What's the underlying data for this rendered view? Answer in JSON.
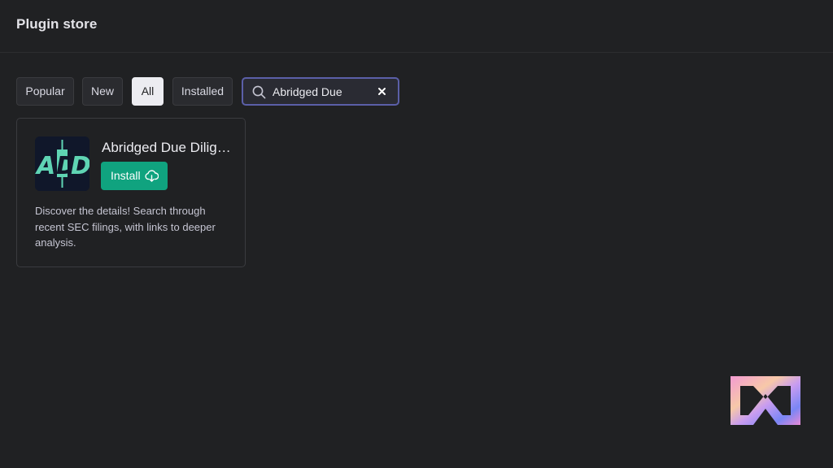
{
  "header": {
    "title": "Plugin store"
  },
  "filters": {
    "tabs": [
      {
        "label": "Popular",
        "active": false
      },
      {
        "label": "New",
        "active": false
      },
      {
        "label": "All",
        "active": true
      },
      {
        "label": "Installed",
        "active": false
      }
    ]
  },
  "search": {
    "value": "Abridged Due",
    "icon": "search-icon",
    "clear_icon": "close-icon"
  },
  "plugin": {
    "name": "Abridged Due Dilig…",
    "logo_text": "ADD",
    "install_label": "Install",
    "install_icon": "cloud-download-icon",
    "description": "Discover the details! Search through recent SEC filings, with links to deeper analysis."
  },
  "colors": {
    "background": "#202123",
    "accent_green": "#10a37f",
    "logo_teal": "#5fd4b4",
    "logo_bg": "#10172a",
    "search_border": "#5b5fa8"
  }
}
